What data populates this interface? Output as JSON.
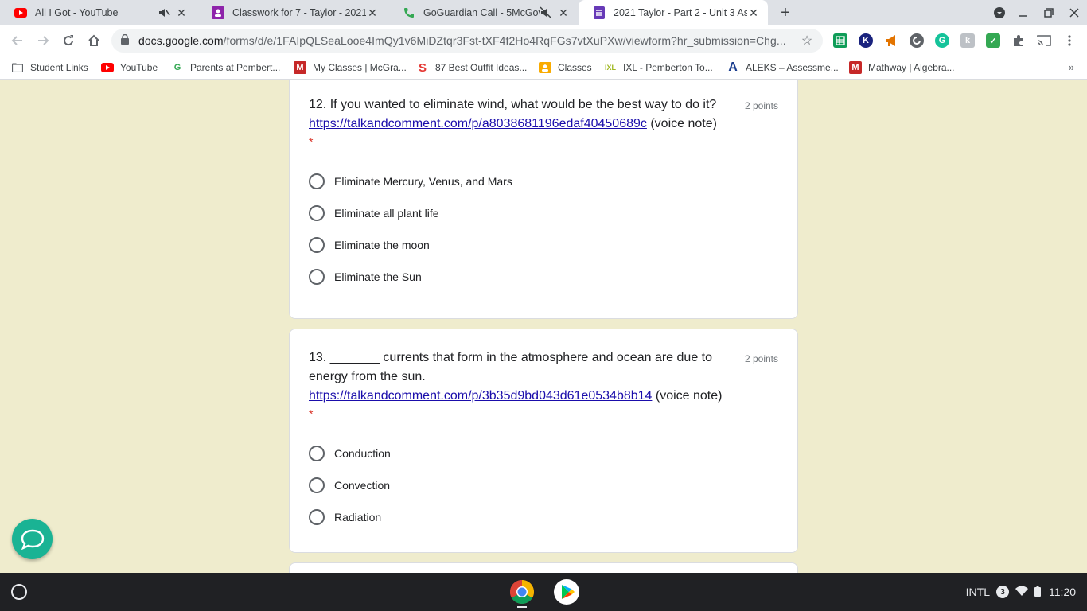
{
  "tabs": [
    {
      "title": "All I Got - YouTube",
      "favicon": "youtube-icon"
    },
    {
      "title": "Classwork for 7 - Taylor - 2021 S",
      "favicon": "classroom-icon"
    },
    {
      "title": "GoGuardian Call - 5McGover",
      "favicon": "phone-icon"
    },
    {
      "title": "2021 Taylor - Part 2 - Unit 3 Asse",
      "favicon": "forms-icon"
    }
  ],
  "omnibox": {
    "host": "docs.google.com",
    "path": "/forms/d/e/1FAIpQLSeaLooe4ImQy1v6MiDZtqr3Fst-tXF4f2Ho4RqFGs7vtXuPXw/viewform?hr_submission=Chg..."
  },
  "bookmarks": [
    {
      "label": "Student Links"
    },
    {
      "label": "YouTube"
    },
    {
      "label": "Parents at Pembert..."
    },
    {
      "label": "My Classes | McGra..."
    },
    {
      "label": "87 Best Outfit Ideas..."
    },
    {
      "label": "Classes"
    },
    {
      "label": "IXL - Pemberton To..."
    },
    {
      "label": "ALEKS – Assessme..."
    },
    {
      "label": "Mathway | Algebra..."
    }
  ],
  "questions": [
    {
      "title": "12. If you wanted to eliminate wind, what would be the best way to do it?",
      "link": "https://talkandcomment.com/p/a8038681196edaf40450689c",
      "link_suffix": " (voice note)",
      "points": "2 points",
      "required": "*",
      "options": [
        "Eliminate Mercury, Venus, and Mars",
        "Eliminate all plant life",
        "Eliminate the moon",
        "Eliminate the Sun"
      ]
    },
    {
      "title_line1": "13. _______ currents that form in the atmosphere and ocean are due to",
      "title_line2": "energy from the sun.",
      "link": "https://talkandcomment.com/p/3b35d9bd043d61e0534b8b14",
      "link_suffix": " (voice note)",
      "points": "2 points",
      "required": "*",
      "options": [
        "Conduction",
        "Convection",
        "Radiation"
      ]
    }
  ],
  "shelf": {
    "ime": "INTL",
    "notification_count": "3",
    "time": "11:20"
  },
  "colors": {
    "page_bg": "#efeccd",
    "link": "#1a0dab",
    "required": "#d93025",
    "chat": "#1ab394"
  }
}
